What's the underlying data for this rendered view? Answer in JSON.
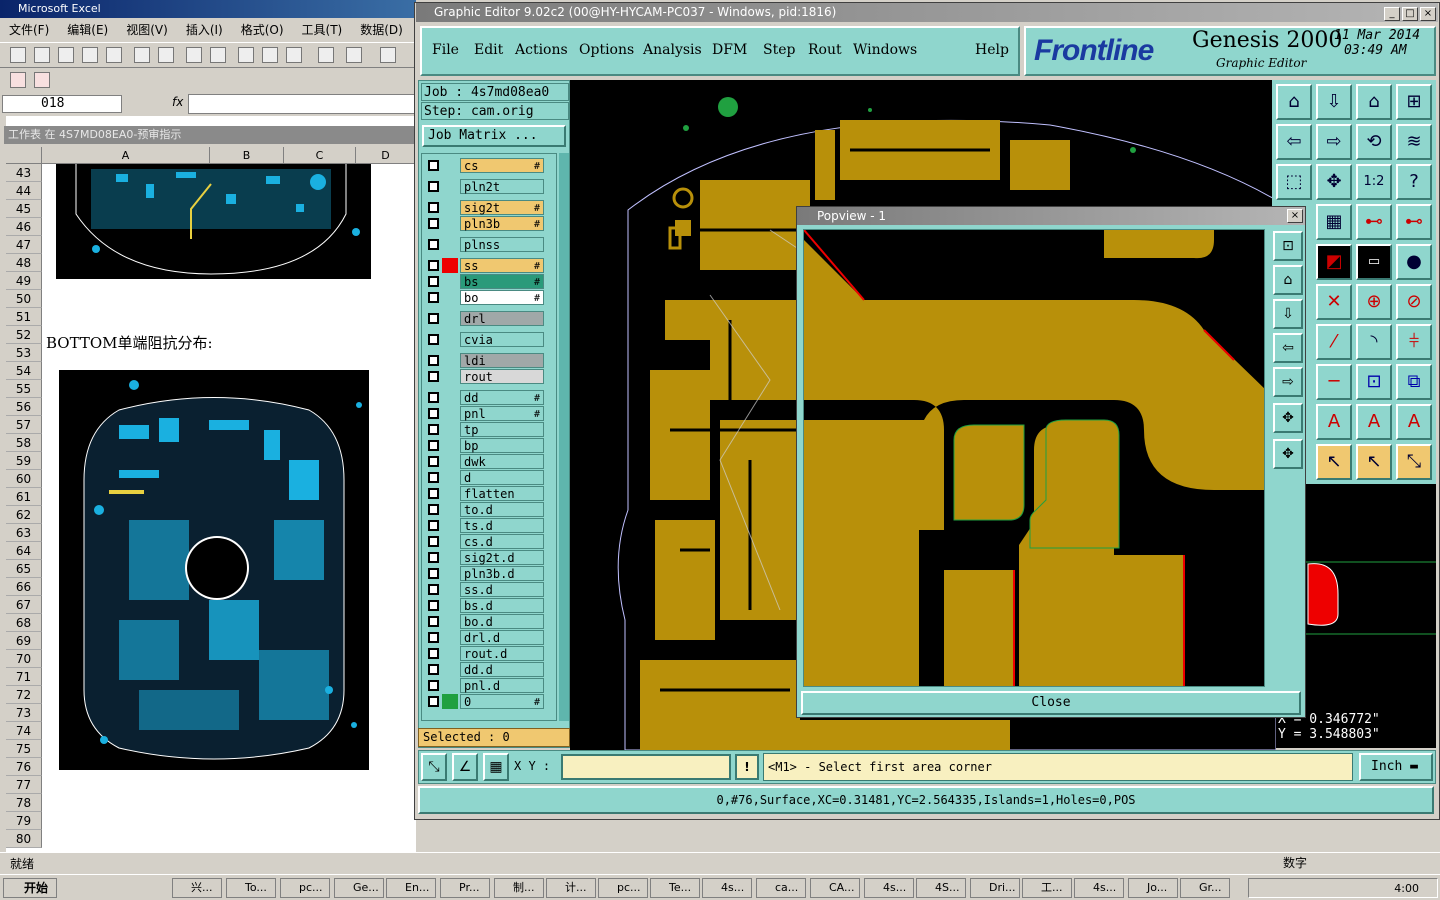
{
  "excel": {
    "title": "Microsoft Excel",
    "menu": [
      "文件(F)",
      "编辑(E)",
      "视图(V)",
      "插入(I)",
      "格式(O)",
      "工具(T)",
      "数据(D)"
    ],
    "name_box": "018",
    "fx": "fx",
    "window_title": "工作表 在 4S7MD08EA0-预审指示",
    "columns": [
      "A",
      "B",
      "C",
      "D"
    ],
    "rows": [
      "43",
      "44",
      "45",
      "46",
      "47",
      "48",
      "49",
      "50",
      "51",
      "52",
      "53",
      "54",
      "55",
      "56",
      "57",
      "58",
      "59",
      "60",
      "61",
      "62",
      "63",
      "64",
      "65",
      "66",
      "67",
      "68",
      "69",
      "70",
      "71",
      "72",
      "73",
      "74",
      "75",
      "76",
      "77",
      "78",
      "79",
      "80"
    ],
    "cell_text": "BOTTOM单端阻抗分布:",
    "status": "就绪",
    "status_right": "数字"
  },
  "genesis": {
    "title": "Graphic Editor 9.02c2 (00@HY-HYCAM-PC037 - Windows, pid:1816)",
    "menu": [
      "File",
      "Edit",
      "Actions",
      "Options",
      "Analysis",
      "DFM",
      "Step",
      "Rout",
      "Windows",
      "Help"
    ],
    "brand": "Frontline",
    "product": "Genesis 2000",
    "subtitle": "Graphic Editor",
    "date": "11 Mar 2014",
    "time": "03:49 AM",
    "job": "Job : 4s7md08ea0",
    "step": "Step: cam.orig",
    "job_matrix": "Job Matrix ...",
    "layers": [
      {
        "name": "cs",
        "color": "#f0c870",
        "mark": "#"
      },
      {
        "name": "pln2t",
        "color": "#8fd6cd",
        "mark": ""
      },
      {
        "name": "sig2t",
        "color": "#f0c870",
        "mark": "#"
      },
      {
        "name": "pln3b",
        "color": "#f0c870",
        "mark": "#"
      },
      {
        "name": "plnss",
        "color": "#8fd6cd",
        "mark": ""
      },
      {
        "name": "ss",
        "color": "#f0c870",
        "mark": "#"
      },
      {
        "name": "bs",
        "color": "#2a9a7a",
        "mark": "#"
      },
      {
        "name": "bo",
        "color": "#ffffff",
        "mark": "#"
      },
      {
        "name": "drl",
        "color": "#a0a8a8",
        "mark": ""
      },
      {
        "name": "cvia",
        "color": "#8fd6cd",
        "mark": ""
      },
      {
        "name": "ldi",
        "color": "#a0a8a8",
        "mark": ""
      },
      {
        "name": "rout",
        "color": "#d8d8d8",
        "mark": ""
      },
      {
        "name": "dd",
        "color": "#8fd6cd",
        "mark": "#"
      },
      {
        "name": "pnl",
        "color": "#8fd6cd",
        "mark": "#"
      },
      {
        "name": "tp",
        "color": "#8fd6cd",
        "mark": ""
      },
      {
        "name": "bp",
        "color": "#8fd6cd",
        "mark": ""
      },
      {
        "name": "dwk",
        "color": "#8fd6cd",
        "mark": ""
      },
      {
        "name": "d",
        "color": "#8fd6cd",
        "mark": ""
      },
      {
        "name": "flatten",
        "color": "#8fd6cd",
        "mark": ""
      },
      {
        "name": "to.d",
        "color": "#8fd6cd",
        "mark": ""
      },
      {
        "name": "ts.d",
        "color": "#8fd6cd",
        "mark": ""
      },
      {
        "name": "cs.d",
        "color": "#8fd6cd",
        "mark": ""
      },
      {
        "name": "sig2t.d",
        "color": "#8fd6cd",
        "mark": ""
      },
      {
        "name": "pln3b.d",
        "color": "#8fd6cd",
        "mark": ""
      },
      {
        "name": "ss.d",
        "color": "#8fd6cd",
        "mark": ""
      },
      {
        "name": "bs.d",
        "color": "#8fd6cd",
        "mark": ""
      },
      {
        "name": "bo.d",
        "color": "#8fd6cd",
        "mark": ""
      },
      {
        "name": "drl.d",
        "color": "#8fd6cd",
        "mark": ""
      },
      {
        "name": "rout.d",
        "color": "#8fd6cd",
        "mark": ""
      },
      {
        "name": "dd.d",
        "color": "#8fd6cd",
        "mark": ""
      },
      {
        "name": "pnl.d",
        "color": "#8fd6cd",
        "mark": ""
      },
      {
        "name": "0",
        "color": "#8fd6cd",
        "mark": "#"
      }
    ],
    "selected": "Selected : 0",
    "xy_label": "X Y :",
    "prompt": "<M1> - Select first area corner",
    "unit": "Inch",
    "x_coord": "X = 0.346772\"",
    "y_coord": "Y = 3.548803\"",
    "info": "0,#76,Surface,XC=0.31481,YC=2.564335,Islands=1,Holes=0,POS",
    "popview_title": "Popview - 1",
    "popview_close": "Close",
    "board_color": "#b8900a"
  },
  "taskbar": {
    "start": "开始",
    "items": [
      "兴...",
      "To...",
      "pc...",
      "Ge...",
      "En...",
      "Pr...",
      "制...",
      "计...",
      "pc...",
      "Te...",
      "4s...",
      "ca...",
      "CA...",
      "4s...",
      "4S...",
      "Dri...",
      "工...",
      "4s...",
      "Jo...",
      "Gr..."
    ],
    "clock": "4:00"
  }
}
